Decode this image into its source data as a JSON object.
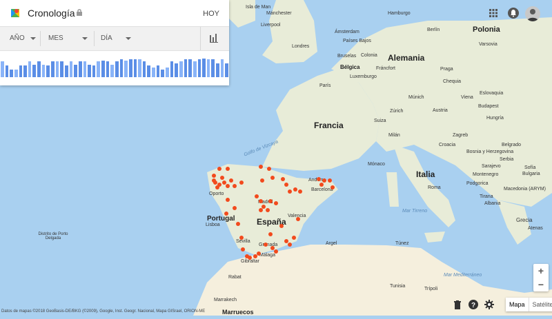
{
  "timeline": {
    "title": "Cronología",
    "today": "HOY",
    "filters": {
      "year": "AÑO",
      "month": "MES",
      "day": "DÍA"
    },
    "bar_values": [
      0.75,
      0.55,
      0.35,
      0.35,
      0.55,
      0.55,
      0.75,
      0.6,
      0.75,
      0.6,
      0.55,
      0.75,
      0.75,
      0.75,
      0.55,
      0.75,
      0.6,
      0.75,
      0.75,
      0.6,
      0.55,
      0.75,
      0.8,
      0.75,
      0.6,
      0.75,
      0.85,
      0.8,
      0.85,
      0.85,
      0.85,
      0.75,
      0.55,
      0.45,
      0.55,
      0.35,
      0.45,
      0.75,
      0.65,
      0.75,
      0.85,
      0.85,
      0.75,
      0.85,
      0.9,
      0.85,
      0.85,
      0.65,
      0.85,
      0.65
    ]
  },
  "map": {
    "labels": {
      "countries": [
        "Francia",
        "España",
        "Portugal",
        "Italia",
        "Alemania",
        "Polonia",
        "Bélgica",
        "Marruecos"
      ],
      "cities": [
        "Isla de Man",
        "Mánchester",
        "Liverpool",
        "Londres",
        "Ámsterdam",
        "Países Bajos",
        "Bruselas",
        "Colonia",
        "Luxemburgo",
        "Fráncfort",
        "París",
        "Praga",
        "Chequia",
        "Eslovaquia",
        "Viena",
        "Austria",
        "Budapest",
        "Hungría",
        "Múnich",
        "Suiza",
        "Zúrich",
        "Milán",
        "Croacia",
        "Zagreb",
        "Bosnia y Herzegovina",
        "Serbia",
        "Sarajevo",
        "Montenegro",
        "Belgrado",
        "Bulgaria",
        "Sofía",
        "Podgorica",
        "Macedonia (ARYM)",
        "Tirana",
        "Albania",
        "Grecia",
        "Atenas",
        "Mónaco",
        "Roma",
        "Andorra",
        "Barcelona",
        "Oporto",
        "Lisboa",
        "Madrid",
        "Valencia",
        "Sevilla",
        "Granada",
        "Málaga",
        "Gibraltar",
        "Argel",
        "Túnez",
        "Tunisia",
        "Trípoli",
        "Rabat",
        "Marrakech",
        "Distrito de Porto Delgada",
        "Berlín",
        "Hamburgo",
        "Varsovia",
        "Golfo de Vizcaya",
        "Mar Tirreno",
        "Mar Mediterráneo"
      ],
      "seas": [
        "Golfo de Vizcaya",
        "Mar Tirreno",
        "Mar Mediterráneo"
      ]
    },
    "points_color": "#f24a1d"
  },
  "controls": {
    "map_type_options": [
      "Mapa",
      "Satélite"
    ],
    "zoom_in": "+",
    "zoom_out": "−",
    "attribution": "Datos de mapas ©2018 GeoBasis-DE/BKG (©2009), Google, Inst. Geogr. Nacional, Mapa GISrael, ORION-ME"
  }
}
